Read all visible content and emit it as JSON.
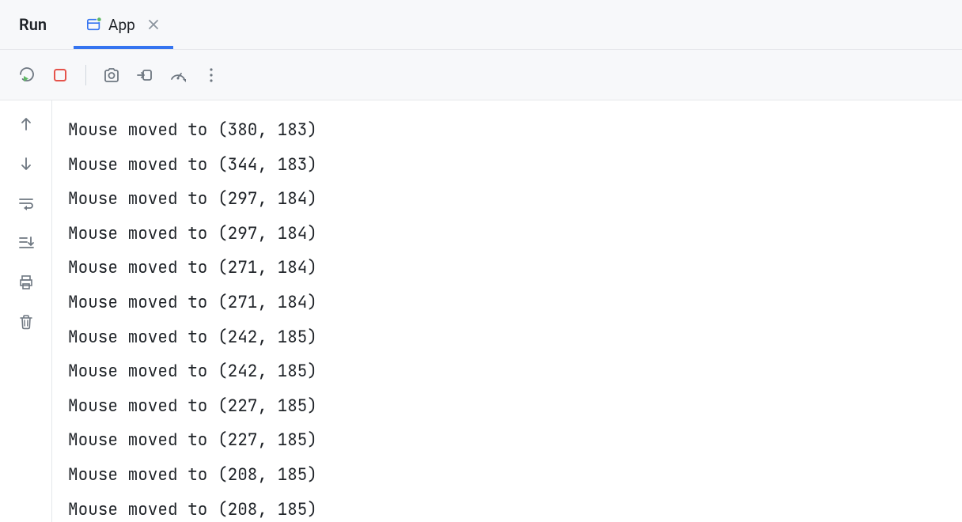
{
  "header": {
    "title": "Run"
  },
  "tabs": [
    {
      "label": "App",
      "active": true
    }
  ],
  "console": {
    "lines": [
      "Mouse moved to (380, 183)",
      "Mouse moved to (344, 183)",
      "Mouse moved to (297, 184)",
      "Mouse moved to (297, 184)",
      "Mouse moved to (271, 184)",
      "Mouse moved to (271, 184)",
      "Mouse moved to (242, 185)",
      "Mouse moved to (242, 185)",
      "Mouse moved to (227, 185)",
      "Mouse moved to (227, 185)",
      "Mouse moved to (208, 185)",
      "Mouse moved to (208, 185)"
    ]
  }
}
